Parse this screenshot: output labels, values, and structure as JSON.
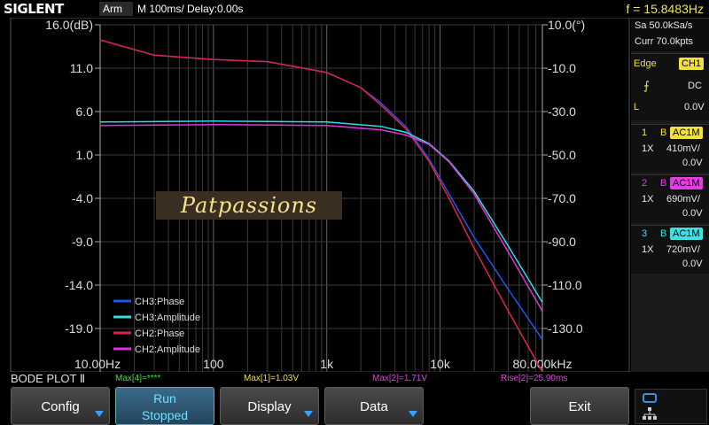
{
  "top": {
    "brand": "SIGLENT",
    "trigger_state": "Arm",
    "timebase": "M 100ms/  Delay:0.00s",
    "frequency": "f = 15.8483Hz"
  },
  "right_panel": {
    "sample_rate": "Sa 50.0kSa/s",
    "memory_depth": "Curr 70.0kpts",
    "trigger_type": "Edge",
    "trigger_source": "CH1",
    "coupling": "DC",
    "level_label": "L",
    "level_value": "0.0V",
    "channels": [
      {
        "num": "1",
        "bw": "B",
        "coupling": "AC1M",
        "probe": "1X",
        "scale": "410mV/",
        "offset": "0.0V",
        "color": "#f0e040"
      },
      {
        "num": "2",
        "bw": "B",
        "coupling": "AC1M",
        "probe": "1X",
        "scale": "690mV/",
        "offset": "0.0V",
        "color": "#e040e0"
      },
      {
        "num": "3",
        "bw": "B",
        "coupling": "AC1M",
        "probe": "1X",
        "scale": "720mV/",
        "offset": "0.0V",
        "color": "#40e0e0"
      }
    ]
  },
  "plot": {
    "left_axis_ticks": [
      "16.0(dB)",
      "11.0",
      "6.0",
      "1.0",
      "-4.0",
      "-9.0",
      "-14.0",
      "-19.0"
    ],
    "right_axis_ticks": [
      "10.0(°)",
      "-10.0",
      "-30.0",
      "-50.0",
      "-70.0",
      "-90.0",
      "-110.0",
      "-130.0"
    ],
    "x_axis_ticks": [
      "10.00Hz",
      "100",
      "1k",
      "10k",
      "80.000kHz"
    ],
    "watermark": "Patpassions",
    "legend": [
      {
        "label": "CH3:Phase",
        "color": "#2255ee"
      },
      {
        "label": "CH3:Amplitude",
        "color": "#33dddd"
      },
      {
        "label": "CH2:Phase",
        "color": "#dd2244"
      },
      {
        "label": "CH2:Amplitude",
        "color": "#dd33dd"
      }
    ]
  },
  "chart_data": {
    "type": "line",
    "x_scale": "log",
    "xlim": [
      10,
      80000
    ],
    "ylim_left": [
      -24,
      16
    ],
    "ylim_right": [
      -150,
      10
    ],
    "series": [
      {
        "name": "CH3:Phase",
        "axis": "right",
        "x": [
          10,
          30,
          100,
          300,
          1000,
          2000,
          3000,
          5000,
          8000,
          12000,
          20000,
          40000,
          80000
        ],
        "y": [
          3,
          -4,
          -6,
          -7,
          -12,
          -19,
          -26,
          -37,
          -52,
          -68,
          -88,
          -112,
          -135
        ]
      },
      {
        "name": "CH2:Phase",
        "axis": "right",
        "x": [
          10,
          30,
          100,
          300,
          1000,
          2000,
          3000,
          5000,
          8000,
          12000,
          20000,
          40000,
          80000
        ],
        "y": [
          3,
          -4,
          -6,
          -7,
          -12,
          -19,
          -27,
          -38,
          -53,
          -70,
          -93,
          -122,
          -150
        ]
      },
      {
        "name": "CH3:Amplitude",
        "axis": "left",
        "x": [
          10,
          100,
          1000,
          3000,
          5000,
          8000,
          12000,
          20000,
          40000,
          80000
        ],
        "y": [
          4.8,
          4.9,
          4.8,
          4.3,
          3.6,
          2.3,
          0.3,
          -3.2,
          -9.5,
          -16
        ]
      },
      {
        "name": "CH2:Amplitude",
        "axis": "left",
        "x": [
          10,
          100,
          1000,
          3000,
          5000,
          8000,
          12000,
          20000,
          40000,
          80000
        ],
        "y": [
          4.4,
          4.5,
          4.4,
          3.9,
          3.3,
          2.2,
          0.2,
          -3.5,
          -10.2,
          -17
        ]
      }
    ]
  },
  "info_strip": {
    "mode": "BODE PLOT Ⅱ",
    "max4": "Max[4]=****",
    "max1": "Max[1]=1.03V",
    "max2": "Max[2]=1.71V",
    "rise2": "Rise[2]=25.90ms"
  },
  "softkeys": {
    "config": "Config",
    "run_line1": "Run",
    "run_line2": "Stopped",
    "display": "Display",
    "data": "Data",
    "exit": "Exit"
  }
}
